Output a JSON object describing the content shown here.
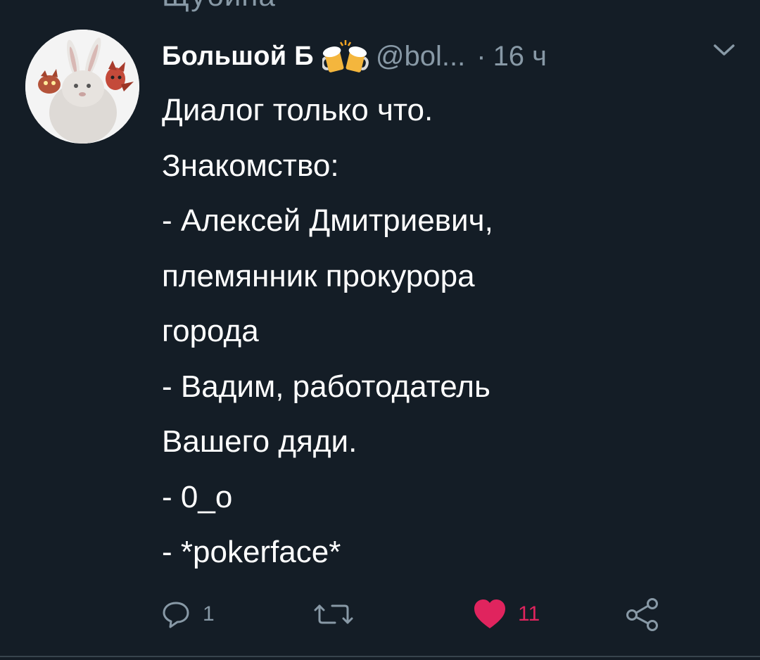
{
  "previous_tweet_fragment": "Щубина",
  "tweet": {
    "author": {
      "display_name": "Большой Б",
      "emoji": "beer-mugs-icon",
      "handle": "@bol...",
      "avatar_icon": "rabbit-avatar-icon"
    },
    "separator": "·",
    "timestamp": "16 ч",
    "text_lines": [
      "Диалог только что.",
      "Знакомство:",
      "- Алексей Дмитриевич,",
      "племянник прокурора",
      "города",
      "- Вадим, работодатель",
      "Вашего дяди.",
      "- 0_о",
      "- *pokerface*"
    ],
    "actions": {
      "reply": {
        "icon": "reply-icon",
        "count": "1"
      },
      "retweet": {
        "icon": "retweet-icon",
        "count": ""
      },
      "like": {
        "icon": "heart-icon",
        "count": "11",
        "active": true,
        "color": "#e0245e"
      },
      "share": {
        "icon": "share-icon"
      }
    }
  },
  "colors": {
    "background": "#141d26",
    "primary_text": "#ffffff",
    "secondary_text": "#8899a6",
    "like_active": "#e0245e"
  }
}
